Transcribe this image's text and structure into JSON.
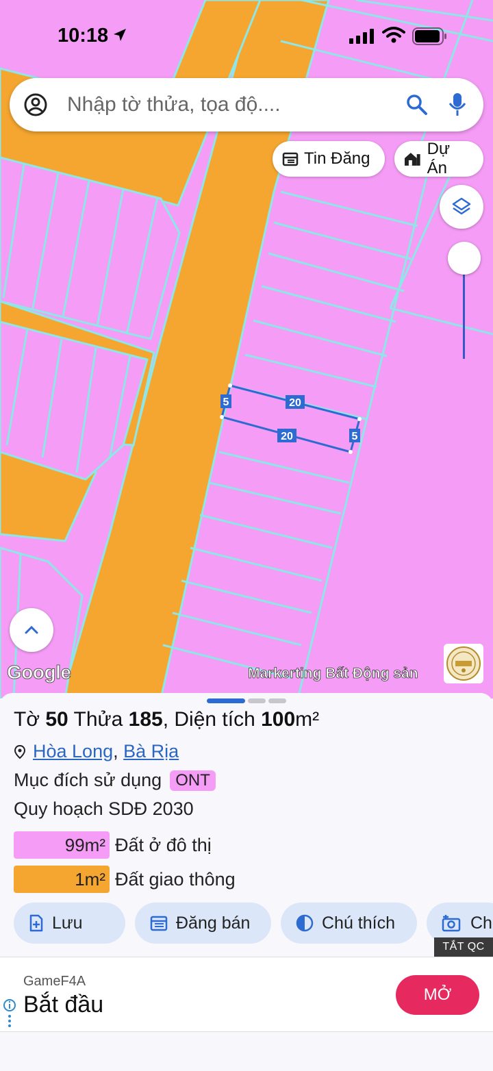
{
  "status_bar": {
    "time": "10:18"
  },
  "search": {
    "placeholder": "Nhập tờ thửa, tọa độ...."
  },
  "chips": {
    "news": "Tin Đăng",
    "project": "Dự Án"
  },
  "map": {
    "parcel_edges": {
      "top": "20",
      "bottom": "20",
      "left": "5",
      "right": "5"
    },
    "google_label": "Google",
    "brand_label": "Markerting Bất Động sản",
    "colors": {
      "residential": "#f59df6",
      "road": "#f5a630",
      "boundary": "#8ee6e6",
      "parcel": "#2d6bd3"
    }
  },
  "parcel": {
    "sheet_prefix": "Tờ",
    "sheet_no": "50",
    "plot_prefix": "Thửa",
    "plot_no": "185",
    "area_label": ", Diện tích",
    "area_value": "100",
    "area_unit": "m²",
    "ward": "Hòa Long",
    "separator": ",",
    "city": "Bà Rịa",
    "purpose_label": "Mục đích sử dụng",
    "purpose_code": "ONT",
    "plan_label": "Quy hoạch SDĐ 2030",
    "allocations": [
      {
        "area": "99m²",
        "label": "Đất ở đô thị",
        "color": "#f59df6"
      },
      {
        "area": "1m²",
        "label": "Đất giao thông",
        "color": "#f5a630"
      }
    ]
  },
  "actions": {
    "save": "Lưu",
    "sell": "Đăng bán",
    "legend": "Chú thích",
    "capture": "Ch"
  },
  "ad": {
    "close_label": "TẮT QC",
    "advertiser": "GameF4A",
    "headline": "Bắt đầu",
    "cta": "MỞ"
  }
}
